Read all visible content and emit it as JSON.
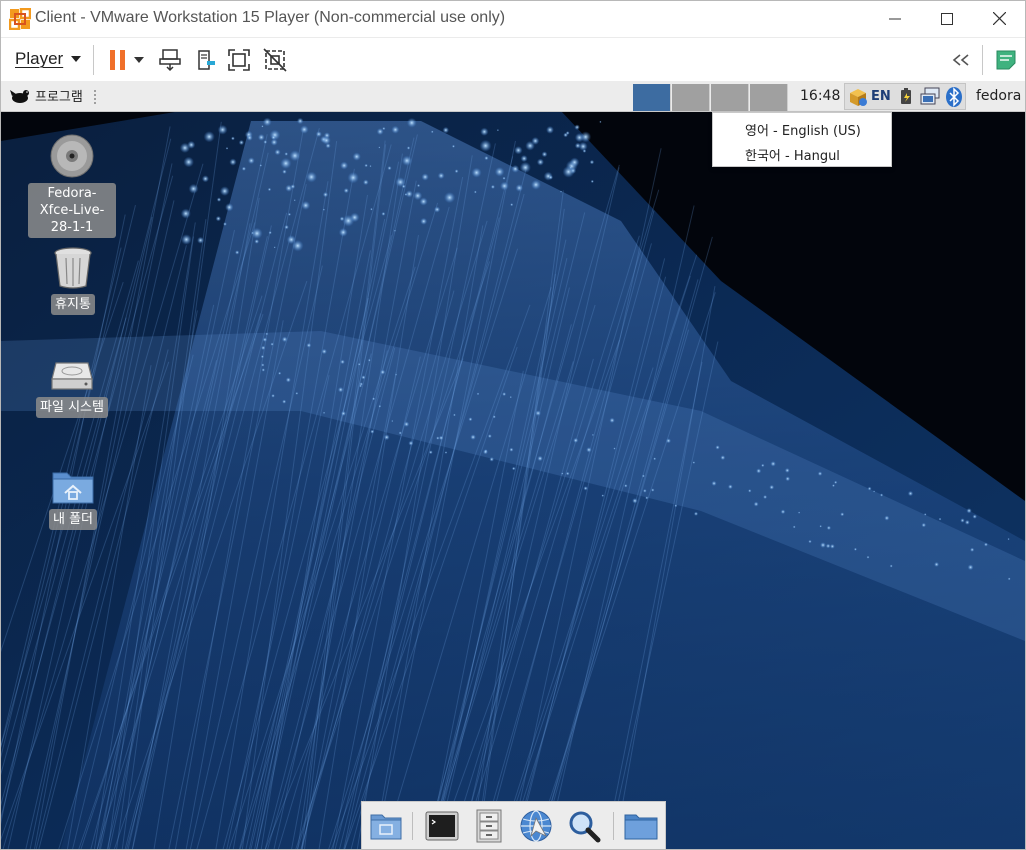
{
  "window": {
    "title": "Client - VMware Workstation 15 Player (Non-commercial use only)"
  },
  "toolbar": {
    "player_label": "Player",
    "icons": [
      "pause-icon",
      "send-ctrl-alt-del-icon",
      "removable-devices-icon",
      "fullscreen-icon",
      "unity-icon",
      "collapse-icon",
      "notes-icon"
    ]
  },
  "panel": {
    "apps_label": "프로그램",
    "workspaces": [
      {
        "name": "workspace-1",
        "active": true
      },
      {
        "name": "workspace-2",
        "active": false
      },
      {
        "name": "workspace-3",
        "active": false
      },
      {
        "name": "workspace-4",
        "active": false
      }
    ],
    "clock": "16:48",
    "language_indicator": "EN",
    "user": "fedora"
  },
  "language_menu": {
    "items": [
      "영어 - English (US)",
      "한국어 - Hangul"
    ]
  },
  "desktop": {
    "icons": [
      {
        "label": "Fedora-Xfce-Live-28-1-1",
        "icon": "disc-icon"
      },
      {
        "label": "휴지통",
        "icon": "trash-icon"
      },
      {
        "label": "파일 시스템",
        "icon": "hard-drive-icon"
      },
      {
        "label": "내 폴더",
        "icon": "home-folder-icon"
      }
    ]
  },
  "dock": {
    "items": [
      "show-desktop-icon",
      "terminal-icon",
      "file-manager-icon",
      "web-browser-icon",
      "app-finder-icon",
      "folder-icon"
    ]
  },
  "colors": {
    "accent_orange": "#f0702a",
    "workspace_active": "#3d6ca1",
    "workspace_inactive": "#a0a0a0"
  }
}
